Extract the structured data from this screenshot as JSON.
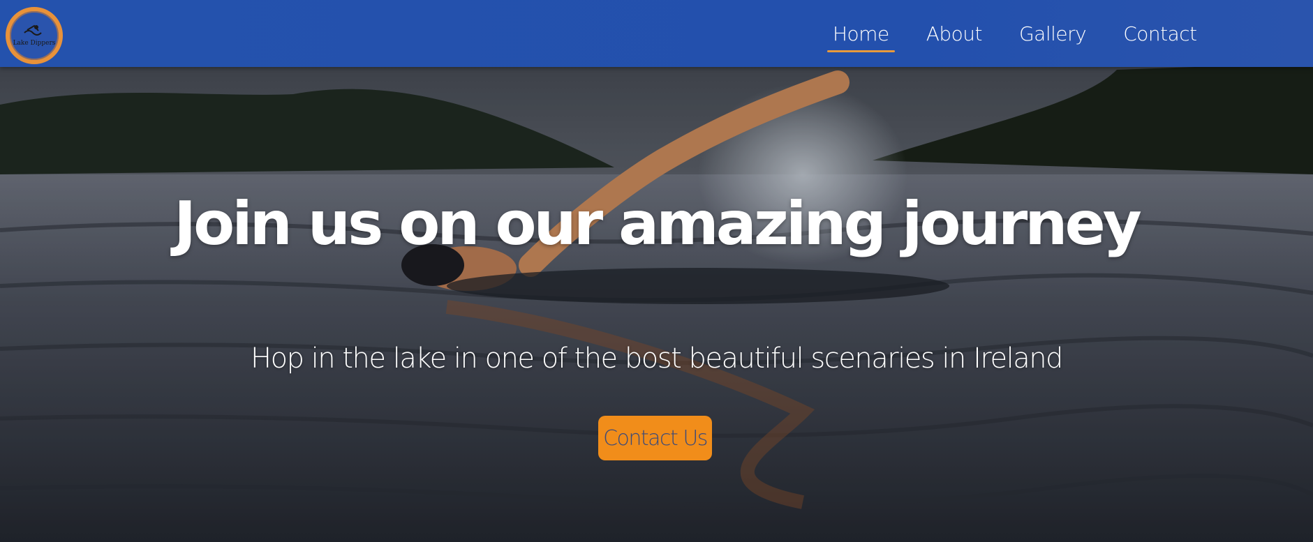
{
  "brand": {
    "logo_text": "Lake Dippers",
    "logo_icon": "swimmer-icon",
    "logo_ring_color": "#e8923a"
  },
  "nav": {
    "items": [
      {
        "label": "Home",
        "active": true
      },
      {
        "label": "About",
        "active": false
      },
      {
        "label": "Gallery",
        "active": false
      },
      {
        "label": "Contact",
        "active": false
      }
    ],
    "background": "#2452ad",
    "active_underline": "#e89a3c"
  },
  "hero": {
    "title": "Join us on our amazing journey",
    "subtitle": "Hop in the lake in one of the bost beautiful scenaries in Ireland",
    "cta_label": "Contact Us",
    "cta_color": "#f18d1a",
    "background_image": "swimmer-in-lake-photo"
  }
}
